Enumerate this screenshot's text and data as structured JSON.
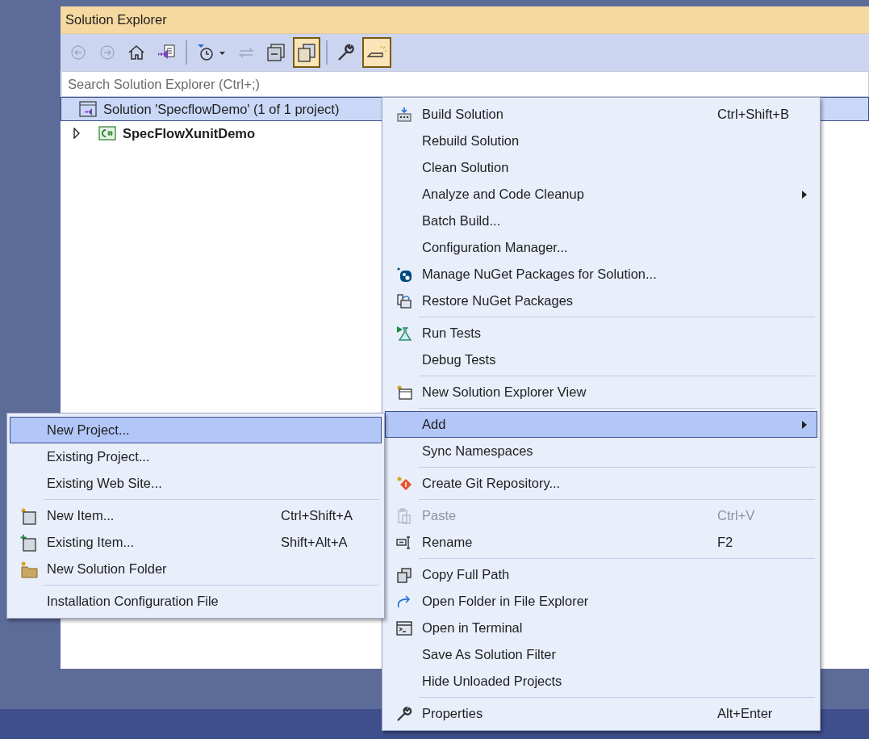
{
  "panel": {
    "title": "Solution Explorer",
    "toolbar": [
      {
        "disabled": true,
        "selected": false
      },
      {
        "disabled": true,
        "selected": false
      },
      {
        "disabled": false,
        "selected": false
      },
      {
        "disabled": false,
        "selected": false
      },
      {
        "disabled": false,
        "selected": false
      },
      {
        "disabled": true,
        "selected": false
      },
      {
        "disabled": false,
        "selected": false
      },
      {
        "disabled": false,
        "selected": true
      },
      {
        "disabled": false,
        "selected": false
      },
      {
        "disabled": false,
        "selected": true
      }
    ],
    "search": {
      "placeholder": "Search Solution Explorer (Ctrl+;)"
    },
    "tree": [
      {
        "label": "Solution 'SpecflowDemo' (1 of 1 project)",
        "selected": true,
        "children": [
          {
            "label": "SpecFlowXunitDemo",
            "selected": false,
            "expanded": false
          }
        ]
      }
    ]
  },
  "context_menu": {
    "items": [
      {
        "kind": "item",
        "label": "Build Solution",
        "shortcut": "Ctrl+Shift+B",
        "submenu": false,
        "disabled": false,
        "selected": false
      },
      {
        "kind": "item",
        "label": "Rebuild Solution",
        "submenu": false,
        "disabled": false,
        "selected": false
      },
      {
        "kind": "item",
        "label": "Clean Solution",
        "submenu": false,
        "disabled": false,
        "selected": false
      },
      {
        "kind": "item",
        "label": "Analyze and Code Cleanup",
        "submenu": true,
        "disabled": false,
        "selected": false
      },
      {
        "kind": "item",
        "label": "Batch Build...",
        "submenu": false,
        "disabled": false,
        "selected": false
      },
      {
        "kind": "item",
        "label": "Configuration Manager...",
        "submenu": false,
        "disabled": false,
        "selected": false
      },
      {
        "kind": "item",
        "label": "Manage NuGet Packages for Solution...",
        "submenu": false,
        "disabled": false,
        "selected": false
      },
      {
        "kind": "item",
        "label": "Restore NuGet Packages",
        "submenu": false,
        "disabled": false,
        "selected": false
      },
      {
        "kind": "separator"
      },
      {
        "kind": "item",
        "label": "Run Tests",
        "submenu": false,
        "disabled": false,
        "selected": false
      },
      {
        "kind": "item",
        "label": "Debug Tests",
        "submenu": false,
        "disabled": false,
        "selected": false
      },
      {
        "kind": "separator"
      },
      {
        "kind": "item",
        "label": "New Solution Explorer View",
        "submenu": false,
        "disabled": false,
        "selected": false
      },
      {
        "kind": "separator"
      },
      {
        "kind": "item",
        "label": "Add",
        "submenu": true,
        "disabled": false,
        "selected": true
      },
      {
        "kind": "item",
        "label": "Sync Namespaces",
        "submenu": false,
        "disabled": false,
        "selected": false
      },
      {
        "kind": "separator"
      },
      {
        "kind": "item",
        "label": "Create Git Repository...",
        "submenu": false,
        "disabled": false,
        "selected": false
      },
      {
        "kind": "separator"
      },
      {
        "kind": "item",
        "label": "Paste",
        "shortcut": "Ctrl+V",
        "submenu": false,
        "disabled": true,
        "selected": false
      },
      {
        "kind": "item",
        "label": "Rename",
        "shortcut": "F2",
        "submenu": false,
        "disabled": false,
        "selected": false
      },
      {
        "kind": "separator"
      },
      {
        "kind": "item",
        "label": "Copy Full Path",
        "submenu": false,
        "disabled": false,
        "selected": false
      },
      {
        "kind": "item",
        "label": "Open Folder in File Explorer",
        "submenu": false,
        "disabled": false,
        "selected": false
      },
      {
        "kind": "item",
        "label": "Open in Terminal",
        "submenu": false,
        "disabled": false,
        "selected": false
      },
      {
        "kind": "item",
        "label": "Save As Solution Filter",
        "submenu": false,
        "disabled": false,
        "selected": false
      },
      {
        "kind": "item",
        "label": "Hide Unloaded Projects",
        "submenu": false,
        "disabled": false,
        "selected": false
      },
      {
        "kind": "separator"
      },
      {
        "kind": "item",
        "label": "Properties",
        "shortcut": "Alt+Enter",
        "submenu": false,
        "disabled": false,
        "selected": false
      }
    ]
  },
  "add_submenu": {
    "items": [
      {
        "kind": "item",
        "label": "New Project...",
        "selected": true
      },
      {
        "kind": "item",
        "label": "Existing Project...",
        "selected": false
      },
      {
        "kind": "item",
        "label": "Existing Web Site...",
        "selected": false
      },
      {
        "kind": "separator"
      },
      {
        "kind": "item",
        "label": "New Item...",
        "shortcut": "Ctrl+Shift+A",
        "selected": false
      },
      {
        "kind": "item",
        "label": "Existing Item...",
        "shortcut": "Shift+Alt+A",
        "selected": false
      },
      {
        "kind": "item",
        "label": "New Solution Folder",
        "selected": false
      },
      {
        "kind": "separator"
      },
      {
        "kind": "item",
        "label": "Installation Configuration File",
        "selected": false
      }
    ]
  }
}
